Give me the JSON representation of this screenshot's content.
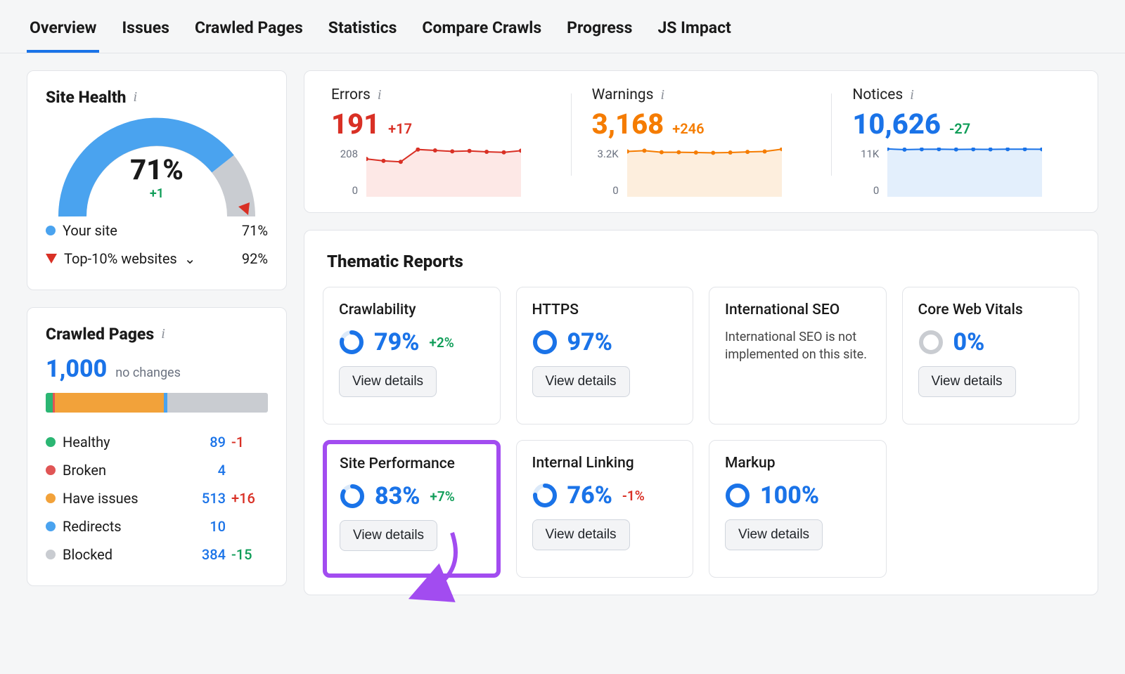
{
  "tabs": [
    "Overview",
    "Issues",
    "Crawled Pages",
    "Statistics",
    "Compare Crawls",
    "Progress",
    "JS Impact"
  ],
  "active_tab": 0,
  "site_health": {
    "title": "Site Health",
    "percent": "71%",
    "delta": "+1",
    "legend": {
      "your_site_label": "Your site",
      "your_site_value": "71%",
      "top10_label": "Top-10% websites",
      "top10_value": "92%"
    }
  },
  "crawled_pages": {
    "title": "Crawled Pages",
    "total": "1,000",
    "total_note": "no changes",
    "segments": [
      {
        "name": "Healthy",
        "count": "89",
        "delta": "-1",
        "delta_color": "red",
        "color": "#2bb673",
        "width": 3.1
      },
      {
        "name": "Broken",
        "count": "4",
        "delta": "",
        "delta_color": "",
        "color": "#e05555",
        "width": 1.0
      },
      {
        "name": "Have issues",
        "count": "513",
        "delta": "+16",
        "delta_color": "red",
        "color": "#f2a23a",
        "width": 49.2
      },
      {
        "name": "Redirects",
        "count": "10",
        "delta": "",
        "delta_color": "",
        "color": "#4aa3ef",
        "width": 1.5
      },
      {
        "name": "Blocked",
        "count": "384",
        "delta": "-15",
        "delta_color": "green",
        "color": "#c9ccd1",
        "width": 45.2
      }
    ]
  },
  "status": {
    "errors": {
      "label": "Errors",
      "value": "191",
      "delta": "+17",
      "axis_top": "208",
      "axis_bot": "0"
    },
    "warnings": {
      "label": "Warnings",
      "value": "3,168",
      "delta": "+246",
      "axis_top": "3.2K",
      "axis_bot": "0"
    },
    "notices": {
      "label": "Notices",
      "value": "10,626",
      "delta": "-27",
      "axis_top": "11K",
      "axis_bot": "0"
    }
  },
  "chart_data": [
    {
      "type": "line",
      "name": "Errors sparkline",
      "ylim": [
        0,
        208
      ],
      "x": [
        1,
        2,
        3,
        4,
        5,
        6,
        7,
        8,
        9,
        10
      ],
      "values": [
        160,
        152,
        148,
        200,
        196,
        192,
        194,
        190,
        188,
        195
      ],
      "stroke": "#d93025",
      "fill": "#fde8e6"
    },
    {
      "type": "line",
      "name": "Warnings sparkline",
      "ylim": [
        0,
        3200
      ],
      "x": [
        1,
        2,
        3,
        4,
        5,
        6,
        7,
        8,
        9,
        10
      ],
      "values": [
        2950,
        3000,
        2900,
        2900,
        2880,
        2860,
        2880,
        2920,
        2950,
        3100
      ],
      "stroke": "#f57c00",
      "fill": "#fdeedd"
    },
    {
      "type": "line",
      "name": "Notices sparkline",
      "ylim": [
        0,
        11000
      ],
      "x": [
        1,
        2,
        3,
        4,
        5,
        6,
        7,
        8,
        9,
        10
      ],
      "values": [
        10700,
        10550,
        10620,
        10650,
        10580,
        10620,
        10600,
        10650,
        10640,
        10626
      ],
      "stroke": "#1a73e8",
      "fill": "#e3effc"
    }
  ],
  "thematic": {
    "title": "Thematic Reports",
    "view_details_label": "View details",
    "reports": [
      {
        "name": "Crawlability",
        "percent": "79%",
        "fill": 79,
        "delta": "+2%",
        "delta_color": "green"
      },
      {
        "name": "HTTPS",
        "percent": "97%",
        "fill": 97,
        "delta": "",
        "delta_color": ""
      },
      {
        "name": "International SEO",
        "note": "International SEO is not implemented on this site."
      },
      {
        "name": "Core Web Vitals",
        "percent": "0%",
        "fill": 0,
        "delta": "",
        "delta_color": "",
        "empty": true
      },
      {
        "name": "Site Performance",
        "percent": "83%",
        "fill": 83,
        "delta": "+7%",
        "delta_color": "green",
        "highlight": true
      },
      {
        "name": "Internal Linking",
        "percent": "76%",
        "fill": 76,
        "delta": "-1%",
        "delta_color": "red"
      },
      {
        "name": "Markup",
        "percent": "100%",
        "fill": 100,
        "delta": "",
        "delta_color": ""
      }
    ]
  }
}
